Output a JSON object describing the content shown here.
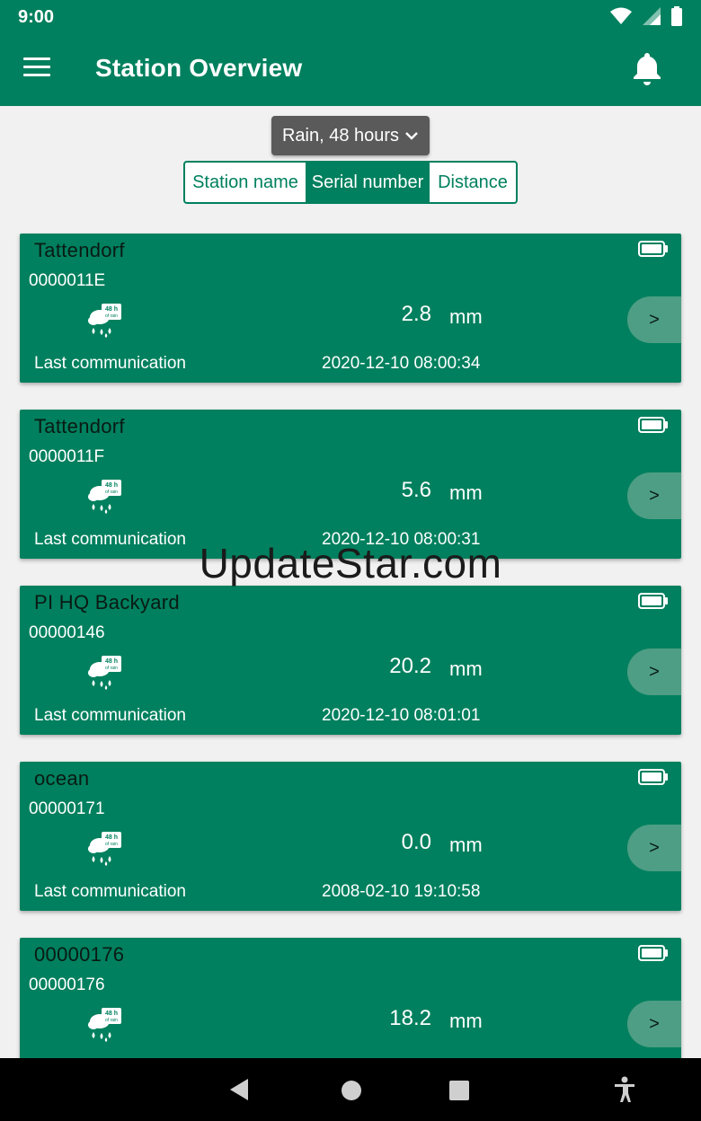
{
  "status": {
    "time": "9:00"
  },
  "appbar": {
    "title": "Station Overview"
  },
  "filter": {
    "selected": "Rain, 48 hours"
  },
  "sort": {
    "options": [
      "Station name",
      "Serial number",
      "Distance"
    ],
    "active": "Serial number"
  },
  "cards": [
    {
      "name": "Tattendorf",
      "serial": "0000011E",
      "value": "2.8",
      "unit": "mm",
      "last_label": "Last communication",
      "last_value": "2020-12-10 08:00:34",
      "go": ">"
    },
    {
      "name": "Tattendorf",
      "serial": "0000011F",
      "value": "5.6",
      "unit": "mm",
      "last_label": "Last communication",
      "last_value": "2020-12-10 08:00:31",
      "go": ">"
    },
    {
      "name": "PI HQ Backyard",
      "serial": "00000146",
      "value": "20.2",
      "unit": "mm",
      "last_label": "Last communication",
      "last_value": "2020-12-10 08:01:01",
      "go": ">"
    },
    {
      "name": "ocean",
      "serial": "00000171",
      "value": "0.0",
      "unit": "mm",
      "last_label": "Last communication",
      "last_value": "2008-02-10 19:10:58",
      "go": ">"
    },
    {
      "name": "00000176",
      "serial": "00000176",
      "value": "18.2",
      "unit": "mm",
      "last_label": "",
      "last_value": "",
      "go": ">"
    }
  ],
  "rain_icon_label": {
    "line1": "48 h",
    "line2": "of rain"
  },
  "watermark": "UpdateStar.com",
  "colors": {
    "primary": "#00805e",
    "go_button": "#4d9e84",
    "dropdown": "#5a5a5a",
    "background": "#f0f1f0"
  }
}
